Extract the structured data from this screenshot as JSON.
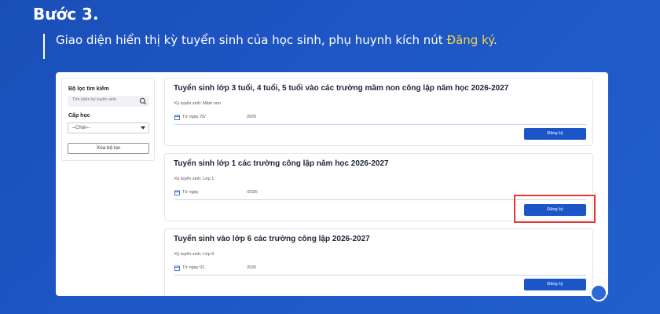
{
  "header": {
    "step": "Bước 3.",
    "desc_main": "Giao diện hiển thị kỳ tuyển sinh của học sinh, phụ huynh kích nút ",
    "desc_highlight": "Đăng ký",
    "desc_end": "."
  },
  "filter": {
    "title": "Bộ lọc tìm kiếm",
    "search_placeholder": "Tìm kiếm kỳ tuyển sinh",
    "level_label": "Cấp học",
    "level_selected": "--Chọn--",
    "clear_label": "Xóa bộ lọc"
  },
  "cards": [
    {
      "title": "Tuyển sinh lớp 3 tuổi, 4 tuổi, 5 tuổi vào các trường mầm non công lập năm học 2026-2027",
      "level": "Kỳ tuyển sinh: Mầm non",
      "date_a": "Từ ngày 25/",
      "date_b": "2026",
      "button": "Đăng ký"
    },
    {
      "title": "Tuyển sinh lớp 1 các trường công lập năm học 2026-2027",
      "level": "Kỳ tuyển sinh: Lớp 1",
      "date_a": "Từ ngày",
      "date_b": "/2026",
      "button": "Đăng ký"
    },
    {
      "title": "Tuyển sinh vào lớp 6 các trường công lập 2026-2027",
      "level": "Kỳ tuyển sinh: Lớp 6",
      "date_a": "Từ ngày 01.",
      "date_b": "2026",
      "button": "Đăng ký"
    }
  ],
  "colors": {
    "background": "#1e56c4",
    "accent": "#1a56c8",
    "highlight_text": "#f7d448",
    "highlight_box": "#e53935"
  },
  "icons": [
    "search-icon",
    "chevron-down-icon",
    "calendar-icon",
    "chat-icon"
  ]
}
